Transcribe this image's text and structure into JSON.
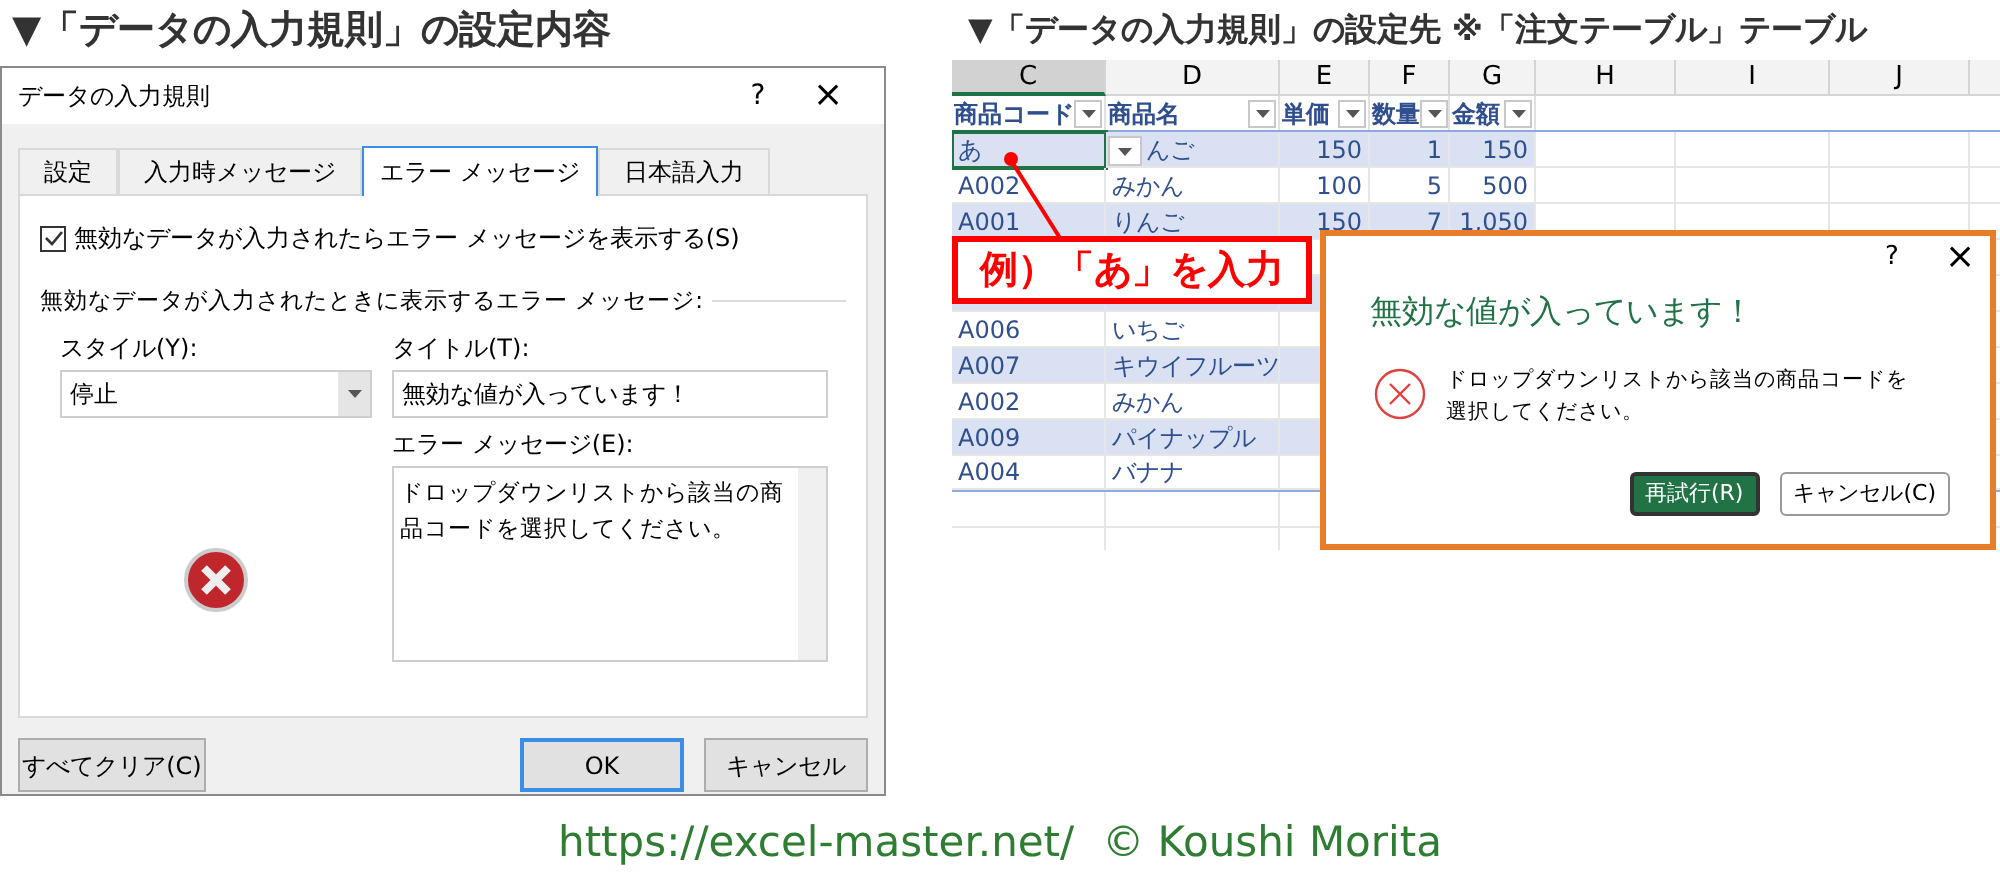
{
  "left_heading": "▼「データの入力規則」の設定内容",
  "validation_dialog": {
    "title": "データの入力規則",
    "help": "?",
    "close": "×",
    "tabs": [
      {
        "label": "設定",
        "selected": false
      },
      {
        "label": "入力時メッセージ",
        "selected": false
      },
      {
        "label": "エラー メッセージ",
        "selected": true
      },
      {
        "label": "日本語入力",
        "selected": false
      }
    ],
    "show_error_checkbox": {
      "label": "無効なデータが入力されたらエラー メッセージを表示する(S)",
      "checked": true
    },
    "group_label": "無効なデータが入力されたときに表示するエラー メッセージ:",
    "style": {
      "label": "スタイル(Y):",
      "value": "停止"
    },
    "title_field": {
      "label": "タイトル(T):",
      "value": "無効な値が入っています！"
    },
    "message_field": {
      "label": "エラー メッセージ(E):",
      "value": "ドロップダウンリストから該当の商品コードを選択してください。"
    },
    "buttons": [
      {
        "label": "すべてクリア(C)",
        "kind": "secondary"
      },
      {
        "label": "OK",
        "kind": "default"
      },
      {
        "label": "キャンセル",
        "kind": "secondary"
      }
    ]
  },
  "right_heading": "▼「データの入力規則」の設定先 ※「注文テーブル」テーブル",
  "sheet": {
    "columns": [
      {
        "label": "C",
        "selected": true
      },
      {
        "label": "D",
        "selected": false
      },
      {
        "label": "E",
        "selected": false
      },
      {
        "label": "F",
        "selected": false
      },
      {
        "label": "G",
        "selected": false
      },
      {
        "label": "H",
        "selected": false
      },
      {
        "label": "I",
        "selected": false
      },
      {
        "label": "J",
        "selected": false
      }
    ],
    "table_headers": [
      "商品コード",
      "商品名",
      "単価",
      "数量",
      "金額"
    ],
    "rows": [
      {
        "cells": [
          "あ",
          "んご",
          "150",
          "1",
          "150"
        ],
        "active": true
      },
      {
        "cells": [
          "A002",
          "みかん",
          "100",
          "5",
          "500"
        ],
        "active": false
      },
      {
        "cells": [
          "A001",
          "りんご",
          "150",
          "7",
          "1,050"
        ],
        "active": false
      },
      {
        "cells": [
          "A006",
          "いちご"
        ],
        "active": false
      },
      {
        "cells": [
          "A007",
          "キウイフルーツ"
        ],
        "active": false
      },
      {
        "cells": [
          "A002",
          "みかん"
        ],
        "active": false
      },
      {
        "cells": [
          "A009",
          "パイナップル"
        ],
        "active": false
      },
      {
        "cells": [
          "A004",
          "バナナ"
        ],
        "active": false
      }
    ]
  },
  "callout": "例）「あ」を入力",
  "error_alert": {
    "help": "?",
    "close": "×",
    "title": "無効な値が入っています！",
    "message": "ドロップダウンリストから該当の商品コードを選択してください。",
    "buttons": [
      {
        "label": "再試行(R)",
        "kind": "primary"
      },
      {
        "label": "キャンセル(C)",
        "kind": "secondary"
      }
    ]
  },
  "footer": {
    "url": "https://excel-master.net/",
    "credit": "© Koushi Morita"
  }
}
